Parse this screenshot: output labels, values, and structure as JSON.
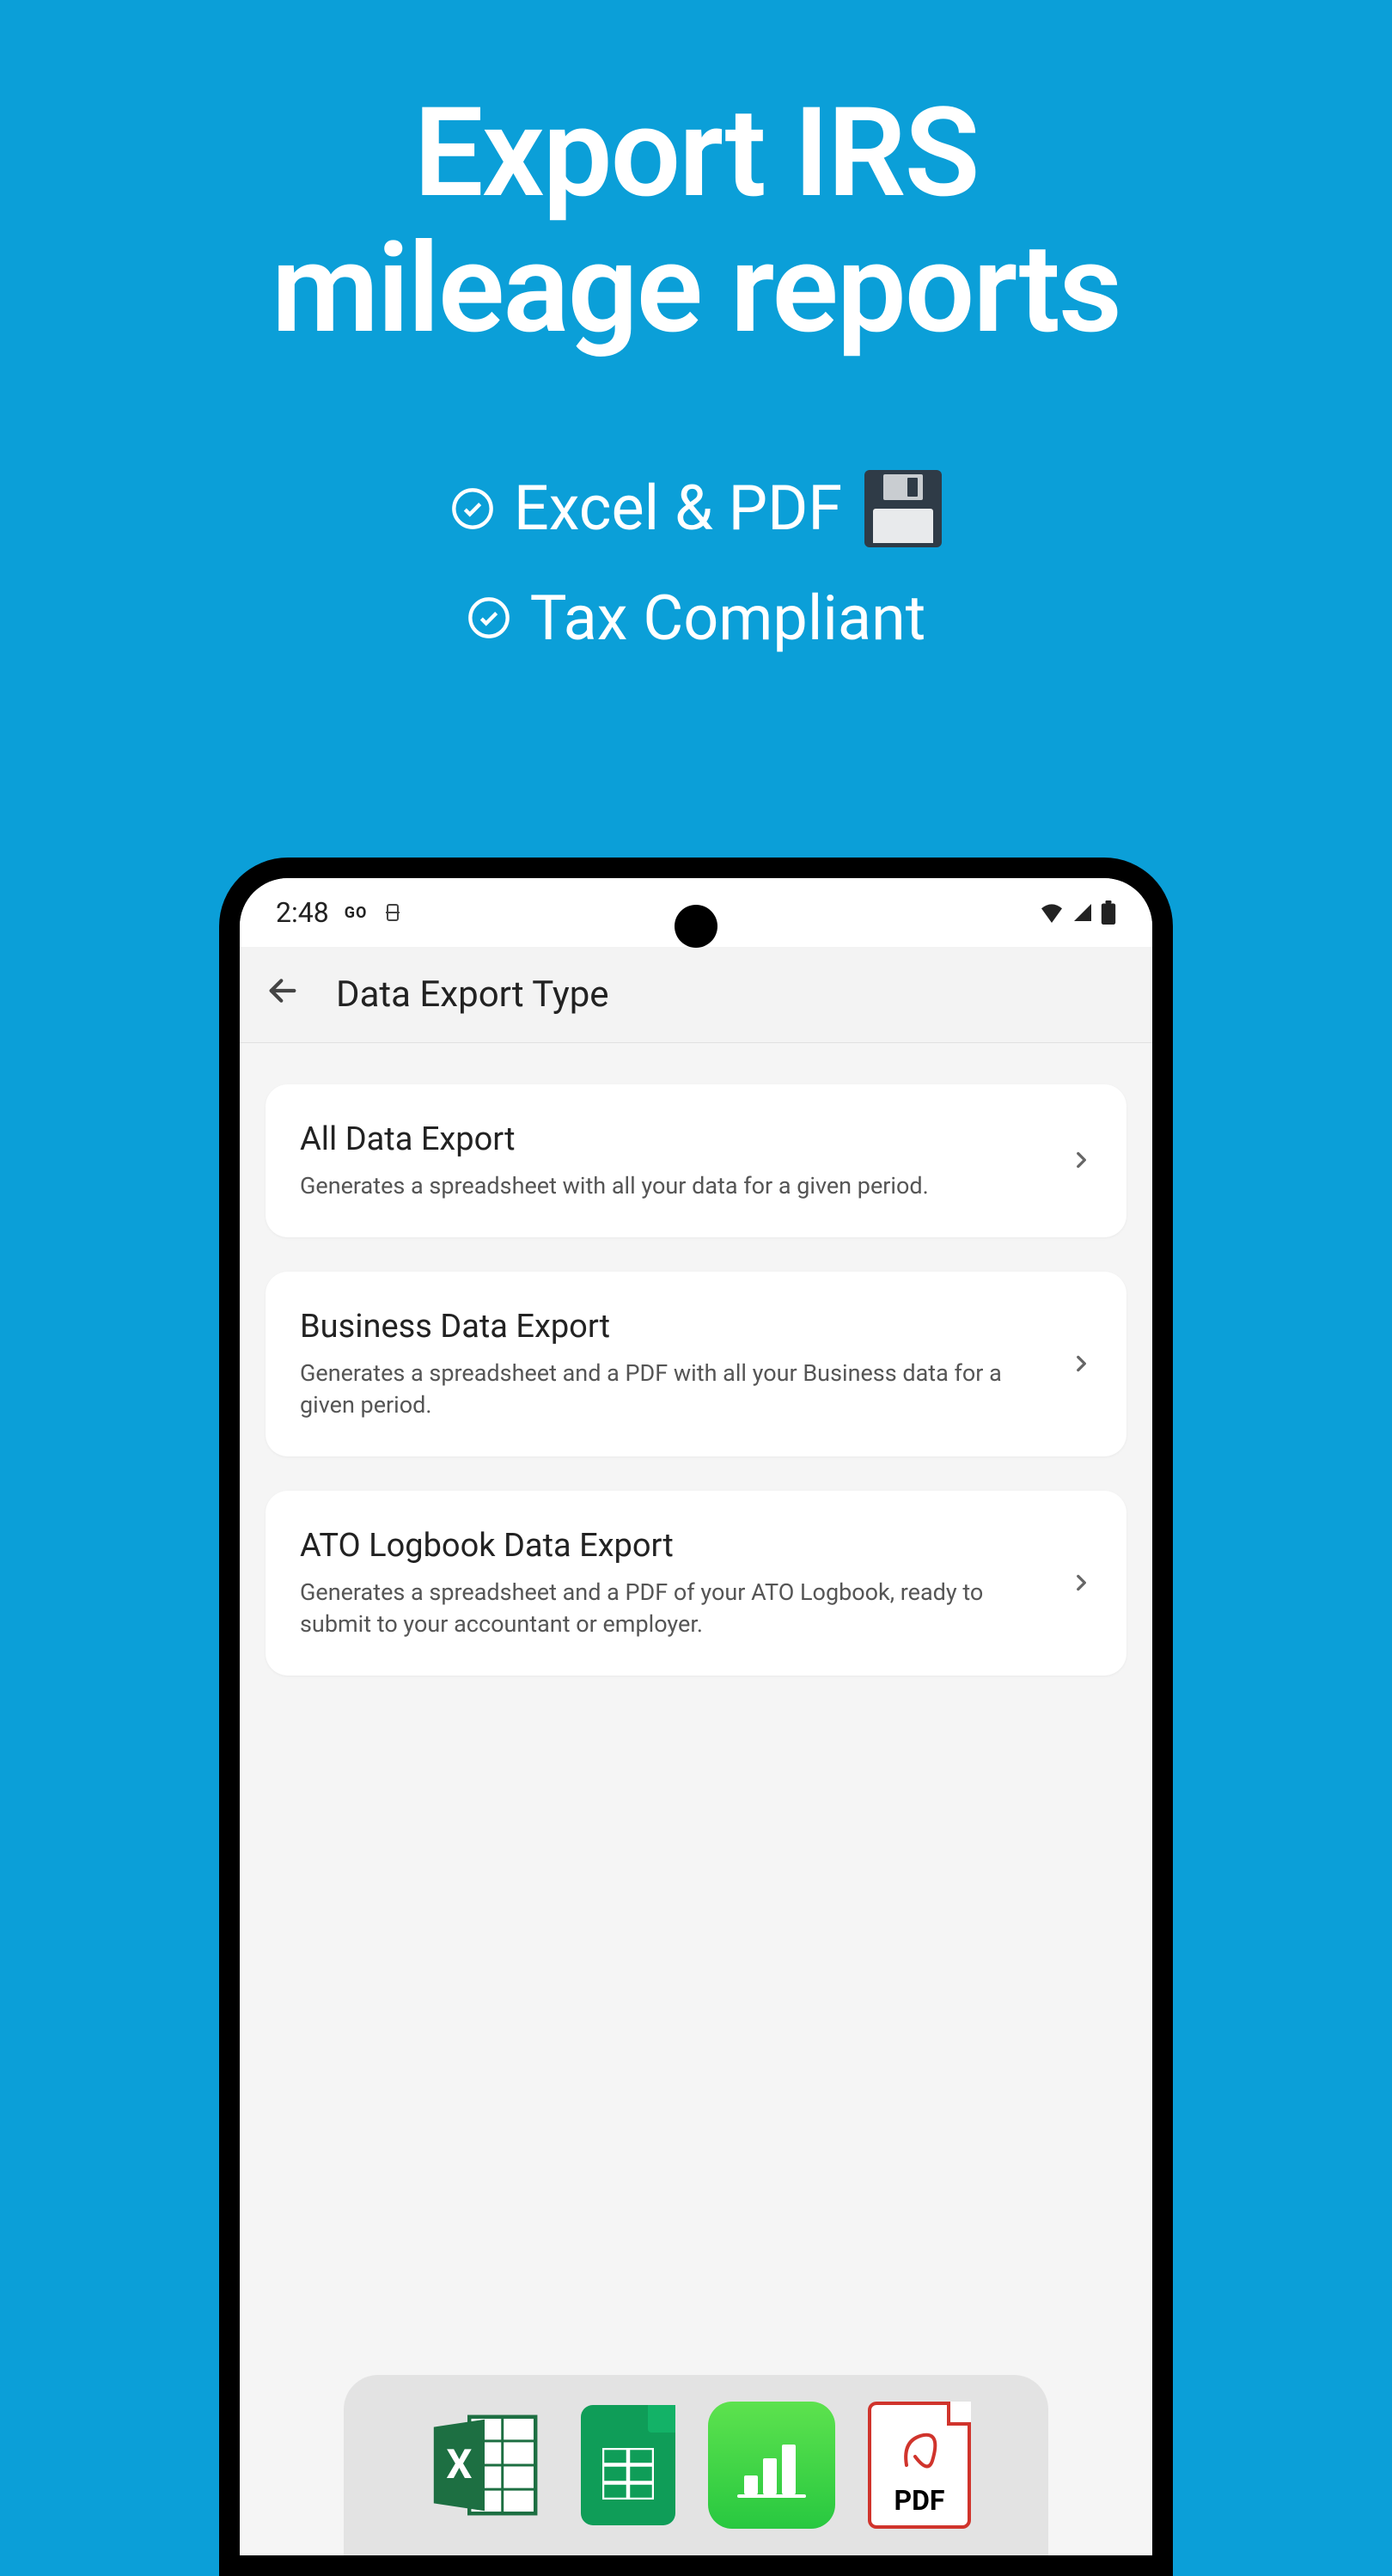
{
  "headline": {
    "line1": "Export IRS",
    "line2": "mileage reports"
  },
  "features": [
    {
      "label": "Excel & PDF",
      "has_icon": true
    },
    {
      "label": "Tax Compliant",
      "has_icon": false
    }
  ],
  "status_bar": {
    "time": "2:48",
    "indicator": "GO"
  },
  "app_bar": {
    "title": "Data Export Type"
  },
  "export_options": [
    {
      "title": "All Data Export",
      "description": "Generates a spreadsheet with all your data for a given period."
    },
    {
      "title": "Business Data Export",
      "description": "Generates a spreadsheet and a PDF with all your Business data for a given period."
    },
    {
      "title": "ATO Logbook Data Export",
      "description": "Generates a spreadsheet and a PDF of your ATO Logbook, ready to submit to your accountant or employer."
    }
  ],
  "format_icons": {
    "pdf_label": "PDF"
  }
}
